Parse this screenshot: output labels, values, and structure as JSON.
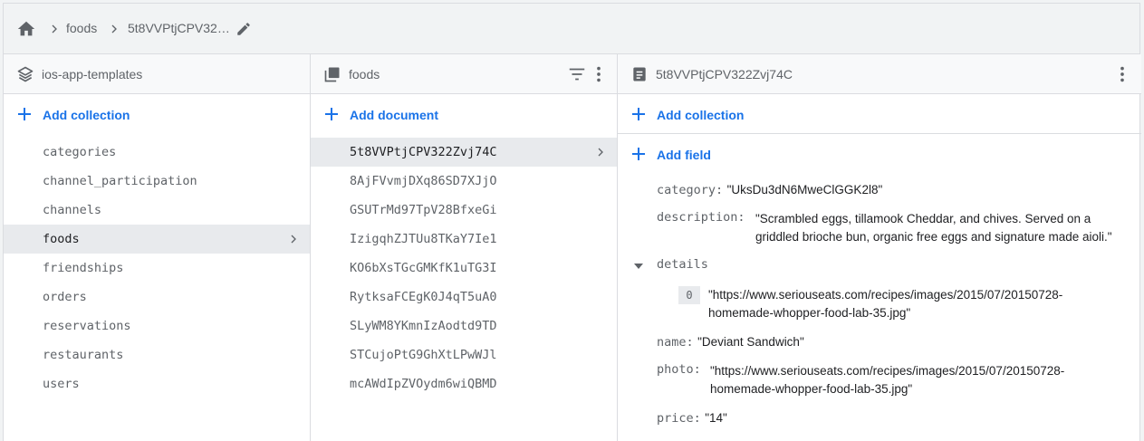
{
  "breadcrumb": {
    "home_icon": "home-icon",
    "items": [
      "foods",
      "5t8VVPtjCPV32…"
    ],
    "edit_icon": "edit-icon"
  },
  "project_panel": {
    "title": "ios-app-templates",
    "add_label": "Add collection",
    "collections": [
      "categories",
      "channel_participation",
      "channels",
      "foods",
      "friendships",
      "orders",
      "reservations",
      "restaurants",
      "users"
    ],
    "selected": "foods"
  },
  "collection_panel": {
    "title": "foods",
    "add_label": "Add document",
    "documents": [
      "5t8VVPtjCPV322Zvj74C",
      "8AjFVvmjDXq86SD7XJjO",
      "GSUTrMd97TpV28BfxeGi",
      "IzigqhZJTUu8TKaY7Ie1",
      "KO6bXsTGcGMKfK1uTG3I",
      "RytksaFCEgK0J4qT5uA0",
      "SLyWM8YKmnIzAodtd9TD",
      "STCujoPtG9GhXtLPwWJl",
      "mcAWdIpZVOydm6wiQBMD"
    ],
    "selected": "5t8VVPtjCPV322Zvj74C"
  },
  "document_panel": {
    "title": "5t8VVPtjCPV322Zvj74C",
    "add_collection_label": "Add collection",
    "add_field_label": "Add field",
    "fields": {
      "category": {
        "key": "category:",
        "value": "\"UksDu3dN6MweClGGK2l8\""
      },
      "description": {
        "key": "description:",
        "value_line1": "\"Scrambled eggs, tillamook Cheddar, and chives. Served on a",
        "value_line2": "griddled brioche bun, organic free eggs and signature made aioli.\""
      },
      "details": {
        "key": "details",
        "index": "0",
        "value_line1": "\"https://www.seriouseats.com/recipes/images/2015/07/20150728-",
        "value_line2": "homemade-whopper-food-lab-35.jpg\""
      },
      "name": {
        "key": "name:",
        "value": "\"Deviant Sandwich\""
      },
      "photo": {
        "key": "photo:",
        "value_line1": "\"https://www.seriouseats.com/recipes/images/2015/07/20150728-",
        "value_line2": "homemade-whopper-food-lab-35.jpg\""
      },
      "price": {
        "key": "price:",
        "value": "\"14\""
      }
    }
  },
  "colors": {
    "accent": "#1a73e8",
    "selected_bg": "#e8eaed",
    "header_bg": "#f1f3f4"
  }
}
